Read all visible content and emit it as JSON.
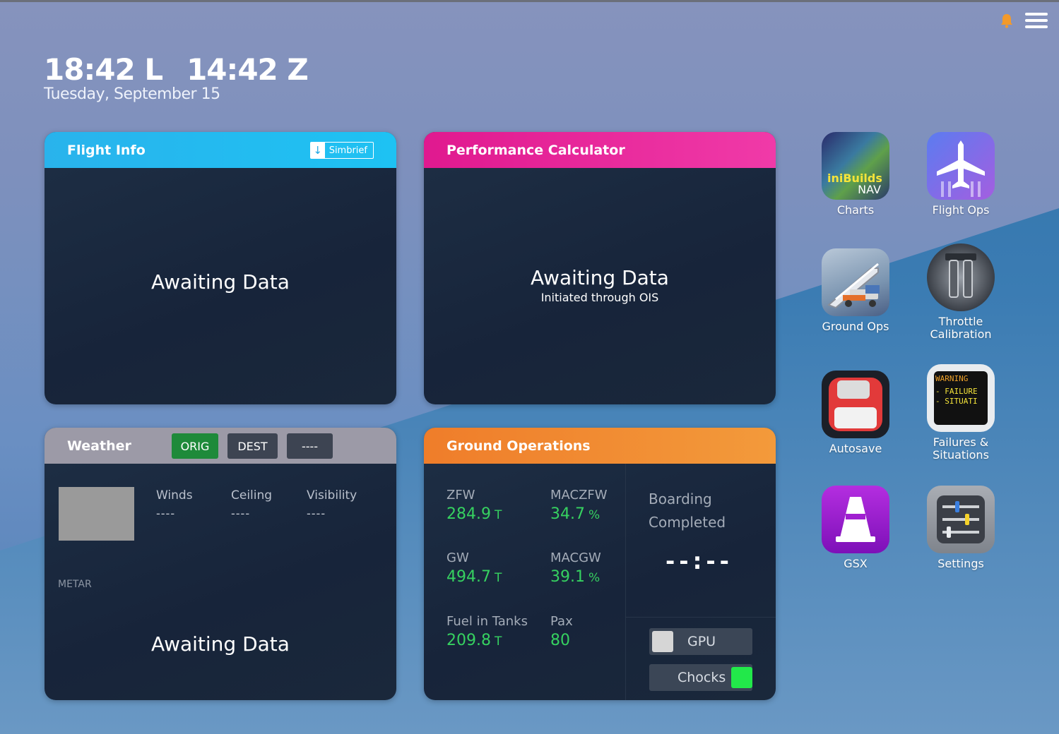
{
  "clock": {
    "local": "18:42 L",
    "zulu": "14:42 Z",
    "date": "Tuesday, September 15"
  },
  "flight_info": {
    "title": "Flight Info",
    "simbrief_label": "Simbrief",
    "status": "Awaiting Data"
  },
  "performance": {
    "title": "Performance Calculator",
    "status": "Awaiting Data",
    "sub": "Initiated through OIS"
  },
  "weather": {
    "title": "Weather",
    "buttons": {
      "orig": "ORIG",
      "dest": "DEST",
      "other": "----"
    },
    "winds_label": "Winds",
    "winds_value": "----",
    "ceiling_label": "Ceiling",
    "ceiling_value": "----",
    "visibility_label": "Visibility",
    "visibility_value": "----",
    "metar_label": "METAR",
    "status": "Awaiting Data"
  },
  "ground_ops": {
    "title": "Ground Operations",
    "zfw_label": "ZFW",
    "zfw_value": "284.9",
    "zfw_unit": "T",
    "maczfw_label": "MACZFW",
    "maczfw_value": "34.7",
    "maczfw_unit": "%",
    "gw_label": "GW",
    "gw_value": "494.7",
    "gw_unit": "T",
    "macgw_label": "MACGW",
    "macgw_value": "39.1",
    "macgw_unit": "%",
    "fuel_label": "Fuel in Tanks",
    "fuel_value": "209.8",
    "fuel_unit": "T",
    "pax_label": "Pax",
    "pax_value": "80",
    "boarding_line1": "Boarding",
    "boarding_line2": "Completed",
    "boarding_time": "--:--",
    "gpu_label": "GPU",
    "chocks_label": "Chocks"
  },
  "apps": {
    "charts": "Charts",
    "charts_brand": "iniBuilds",
    "charts_sub": "NAV",
    "flight_ops": "Flight Ops",
    "ground_ops": "Ground Ops",
    "throttle": "Throttle Calibration",
    "autosave": "Autosave",
    "failures": "Failures & Situations",
    "failures_screen1": "WARNING",
    "failures_screen2": "- FAILURE",
    "failures_screen3": "- SITUATI",
    "gsx": "GSX",
    "settings": "Settings"
  },
  "colors": {
    "flight_info": "#1ec2f3",
    "performance": "#e0198f",
    "weather": "#9c9aa7",
    "ground_ops": "#ef7d2a",
    "green_value": "#36d160",
    "orig_active": "#1e8a3a",
    "chocks_on": "#22e84a",
    "bell": "#f39a2b"
  },
  "icons": [
    "bell-icon",
    "menu-icon",
    "download-icon",
    "airplane-icon",
    "stairs-truck-icon",
    "throttle-icon",
    "floppy-disk-icon",
    "cone-icon",
    "sliders-icon"
  ]
}
